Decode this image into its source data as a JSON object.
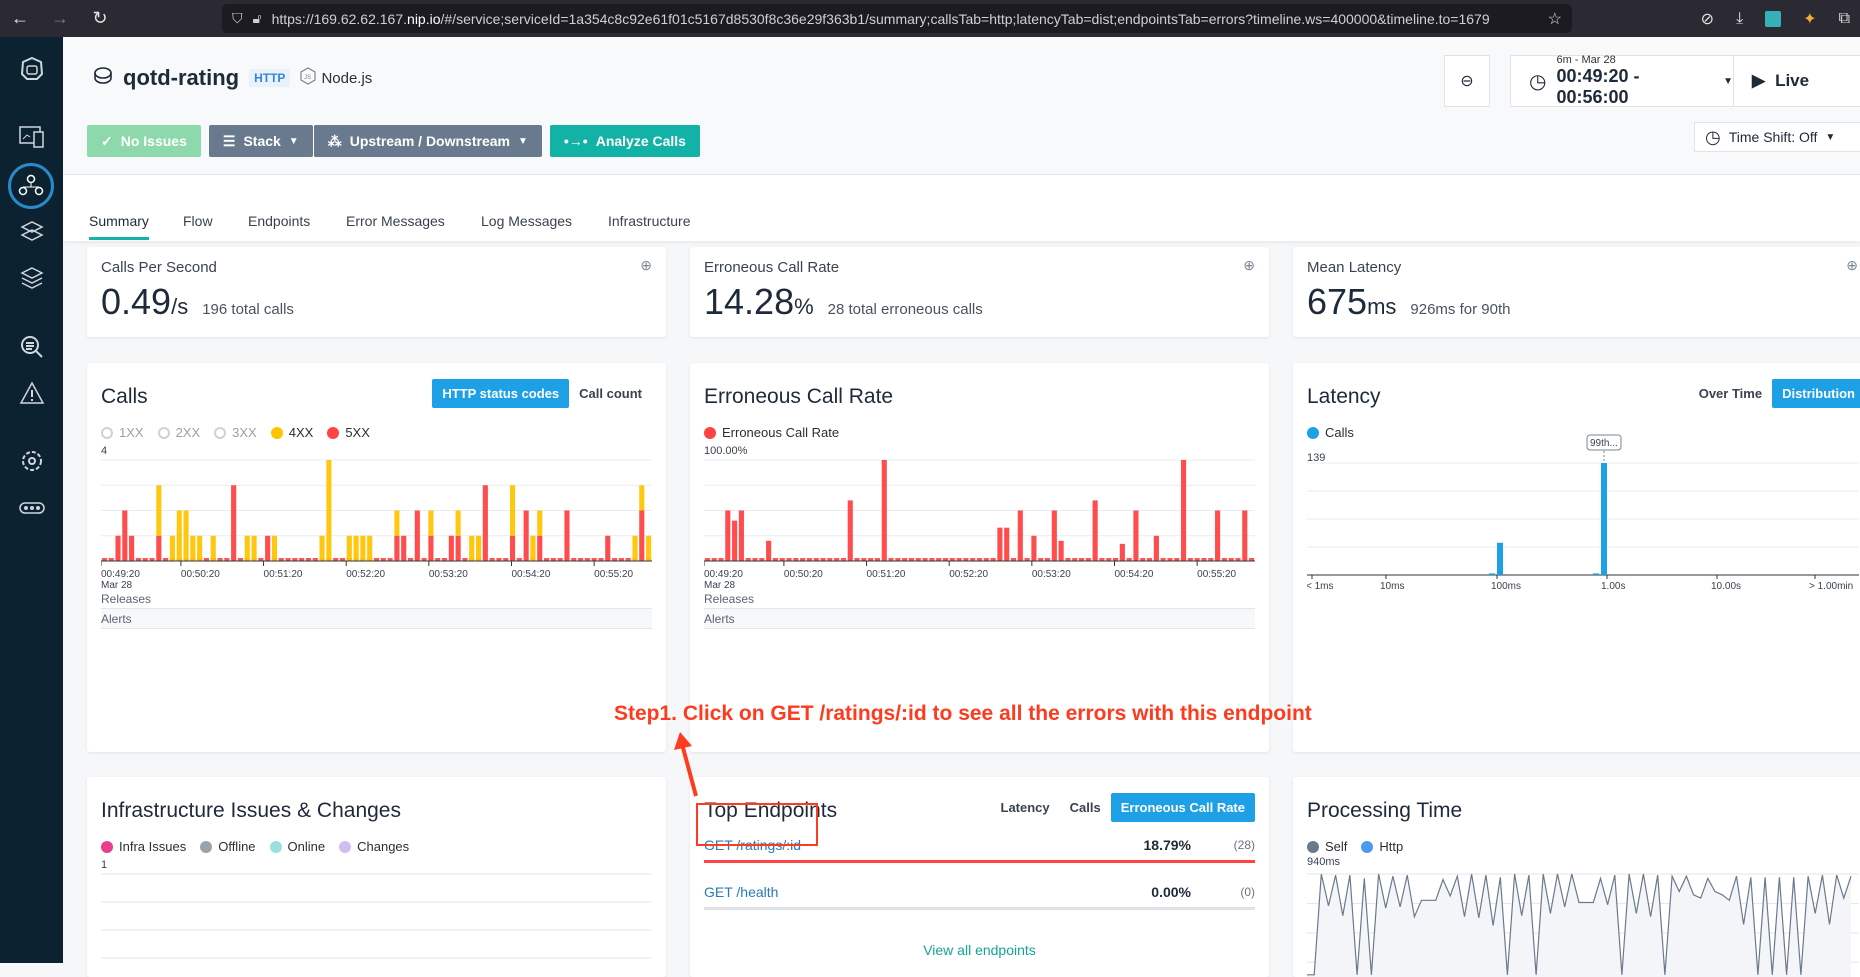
{
  "browser": {
    "url_prefix": "https://169.62.62.167.",
    "url_host": "nip.io",
    "url_rest": "/#/service;serviceId=1a354c8c92e61f01c5167d8530f8c36e29f363b1/summary;callsTab=http;latencyTab=dist;endpointsTab=errors?timeline.ws=400000&timeline.to=1679"
  },
  "sidebar": {
    "items": [
      "logo",
      "websites-mobile-apps",
      "applications",
      "platforms",
      "infrastructure",
      "analytics",
      "events",
      "settings",
      "more"
    ],
    "active": "applications"
  },
  "header": {
    "service_name": "qotd-rating",
    "protocol_badge": "HTTP",
    "technology": "Node.js",
    "toolbar": {
      "no_issues": "No Issues",
      "stack": "Stack",
      "upstream_downstream": "Upstream / Downstream",
      "analyze_calls": "Analyze Calls"
    },
    "time_range": {
      "label": "6m - Mar 28",
      "range": "00:49:20 - 00:56:00"
    },
    "live_label": "Live",
    "time_shift": "Time Shift: Off"
  },
  "tabs": [
    "Summary",
    "Flow",
    "Endpoints",
    "Error Messages",
    "Log Messages",
    "Infrastructure"
  ],
  "active_tab": "Summary",
  "metrics": [
    {
      "title": "Calls Per Second",
      "value": "0.49",
      "unit": "/s",
      "sub": "196 total calls"
    },
    {
      "title": "Erroneous Call Rate",
      "value": "14.28",
      "unit": "%",
      "sub": "28 total erroneous calls"
    },
    {
      "title": "Mean Latency",
      "value": "675",
      "unit": "ms",
      "sub": "926ms for 90th"
    }
  ],
  "calls_card": {
    "title": "Calls",
    "seg": [
      "HTTP status codes",
      "Call count"
    ],
    "active_seg": "HTTP status codes",
    "legend": [
      {
        "label": "1XX",
        "enabled": false
      },
      {
        "label": "2XX",
        "enabled": false
      },
      {
        "label": "3XX",
        "enabled": false
      },
      {
        "label": "4XX",
        "enabled": true,
        "color": "#ffc400"
      },
      {
        "label": "5XX",
        "enabled": true,
        "color": "#ff4242"
      }
    ],
    "y_max_label": "4",
    "bands": [
      "Releases",
      "Alerts"
    ]
  },
  "error_card": {
    "title": "Erroneous Call Rate",
    "legend": [
      {
        "label": "Erroneous Call Rate",
        "color": "#ff4242"
      }
    ],
    "y_max_label": "100.00%",
    "bands": [
      "Releases",
      "Alerts"
    ]
  },
  "latency_card": {
    "title": "Latency",
    "seg": [
      "Over Time",
      "Distribution"
    ],
    "active_seg": "Distribution",
    "legend": [
      {
        "label": "Calls",
        "color": "#1ea0e6"
      }
    ],
    "y_max_label": "139",
    "marker_label": "99th..."
  },
  "infra_card": {
    "title": "Infrastructure Issues & Changes",
    "legend": [
      {
        "label": "Infra Issues",
        "color": "#e83e8c"
      },
      {
        "label": "Offline",
        "color": "#9aa3aa"
      },
      {
        "label": "Online",
        "color": "#9be0e0"
      },
      {
        "label": "Changes",
        "color": "#d2bdf0"
      }
    ],
    "y_max_label": "1"
  },
  "endpoints_card": {
    "title": "Top Endpoints",
    "seg": [
      "Latency",
      "Calls",
      "Erroneous Call Rate"
    ],
    "active_seg": "Erroneous Call Rate",
    "rows": [
      {
        "name": "GET /ratings/:id",
        "pct": "18.79%",
        "count": "(28)",
        "fraction": 1.0,
        "color": "#ff4242"
      },
      {
        "name": "GET /health",
        "pct": "0.00%",
        "count": "(0)",
        "fraction": 1.0,
        "color": "#dfe3e8"
      }
    ],
    "view_all": "View all endpoints"
  },
  "processing_card": {
    "title": "Processing Time",
    "legend": [
      {
        "label": "Self",
        "color": "#6a7a8e"
      },
      {
        "label": "Http",
        "color": "#4a9af0"
      }
    ],
    "y_max_label": "940ms"
  },
  "annotation": {
    "text": "Step1. Click on GET /ratings/:id to see all the errors with this endpoint"
  },
  "chart_data": [
    {
      "type": "bar",
      "title": "Calls",
      "stacked": true,
      "x_ticks": [
        "00:49:20",
        "00:50:20",
        "00:51:20",
        "00:52:20",
        "00:53:20",
        "00:54:20",
        "00:55:20"
      ],
      "x_sub_label": "Mar 28",
      "ylim": [
        0,
        4
      ],
      "series": [
        {
          "name": "5XX",
          "color": "#ff4242",
          "values": [
            0,
            0,
            1,
            2,
            1,
            0,
            0,
            0,
            1,
            0,
            0,
            0,
            0,
            0,
            0,
            0,
            0,
            0,
            0,
            3,
            0,
            0,
            0,
            0,
            1,
            0,
            0,
            0,
            0,
            0,
            0,
            0,
            0,
            0,
            0,
            0,
            0,
            0,
            0,
            0,
            0,
            0,
            0,
            1,
            1,
            0,
            2,
            0,
            1,
            0,
            0,
            1,
            1,
            0,
            0,
            0,
            3,
            0,
            0,
            0,
            1,
            0,
            2,
            0,
            1,
            0,
            0,
            0,
            2,
            0,
            0,
            0,
            0,
            0,
            1,
            0,
            0,
            0,
            0,
            2,
            0
          ]
        },
        {
          "name": "4XX",
          "color": "#ffc400",
          "values": [
            0,
            0,
            0,
            0,
            0,
            0,
            0,
            0,
            2,
            0,
            1,
            2,
            2,
            1,
            1,
            0,
            1,
            0,
            0,
            0,
            0,
            1,
            1,
            0,
            0,
            1,
            0,
            0,
            0,
            0,
            0,
            0,
            1,
            4,
            0,
            0,
            1,
            1,
            1,
            1,
            0,
            0,
            0,
            1,
            0,
            0,
            0,
            0,
            1,
            0,
            0,
            0,
            1,
            0,
            1,
            1,
            0,
            0,
            0,
            0,
            2,
            0,
            0,
            1,
            1,
            0,
            0,
            0,
            0,
            0,
            0,
            0,
            0,
            0,
            0,
            0,
            0,
            0,
            1,
            1,
            1
          ]
        }
      ]
    },
    {
      "type": "bar",
      "title": "Erroneous Call Rate",
      "x_ticks": [
        "00:49:20",
        "00:50:20",
        "00:51:20",
        "00:52:20",
        "00:53:20",
        "00:54:20",
        "00:55:20"
      ],
      "x_sub_label": "Mar 28",
      "ylim": [
        0,
        100
      ],
      "unit": "%",
      "series": [
        {
          "name": "Erroneous Call Rate",
          "color": "#ff4242",
          "values": [
            0,
            0,
            0,
            50,
            40,
            50,
            0,
            0,
            0,
            20,
            0,
            0,
            0,
            0,
            0,
            0,
            0,
            0,
            0,
            0,
            0,
            60,
            0,
            0,
            0,
            0,
            100,
            0,
            0,
            0,
            0,
            0,
            0,
            0,
            0,
            0,
            0,
            0,
            0,
            0,
            0,
            0,
            0,
            33,
            33,
            0,
            50,
            0,
            25,
            0,
            0,
            50,
            20,
            0,
            0,
            0,
            0,
            60,
            0,
            0,
            0,
            17,
            0,
            50,
            0,
            0,
            25,
            0,
            0,
            0,
            100,
            0,
            0,
            0,
            0,
            50,
            0,
            0,
            0,
            50,
            0
          ]
        }
      ]
    },
    {
      "type": "bar",
      "title": "Latency Distribution",
      "x_ticks": [
        "< 1ms",
        "10ms",
        "100ms",
        "1.00s",
        "10.00s",
        "> 1.00min"
      ],
      "ylim": [
        0,
        139
      ],
      "series": [
        {
          "name": "Calls",
          "color": "#1ea0e6",
          "points": [
            {
              "x": "~90ms",
              "value": 2
            },
            {
              "x": "~100ms",
              "value": 40
            },
            {
              "x": "~850ms",
              "value": 2
            },
            {
              "x": "~900ms",
              "value": 139
            }
          ]
        }
      ],
      "annotations": [
        {
          "label": "99th...",
          "x": "~900ms"
        }
      ]
    },
    {
      "type": "line",
      "title": "Processing Time",
      "ylim": [
        0,
        940
      ],
      "unit": "ms",
      "series": [
        {
          "name": "Self",
          "color": "#6a7a8e",
          "values": [
            20,
            20,
            940,
            650,
            930,
            560,
            930,
            20,
            900,
            20,
            940,
            630,
            920,
            640,
            930,
            550,
            700,
            700,
            700,
            890,
            740,
            920,
            550,
            940,
            540,
            930,
            470,
            910,
            20,
            940,
            560,
            930,
            20,
            940,
            580,
            940,
            640,
            940,
            680,
            680,
            680,
            900,
            660,
            930,
            20,
            940,
            580,
            940,
            550,
            930,
            20,
            920,
            780,
            920,
            750,
            720,
            900,
            780,
            750,
            700,
            920,
            480,
            910,
            20,
            910,
            20,
            910,
            20,
            910,
            20,
            920,
            580,
            930,
            480,
            930,
            720,
            920
          ]
        },
        {
          "name": "Http",
          "color": "#4a9af0",
          "values": []
        }
      ]
    }
  ]
}
